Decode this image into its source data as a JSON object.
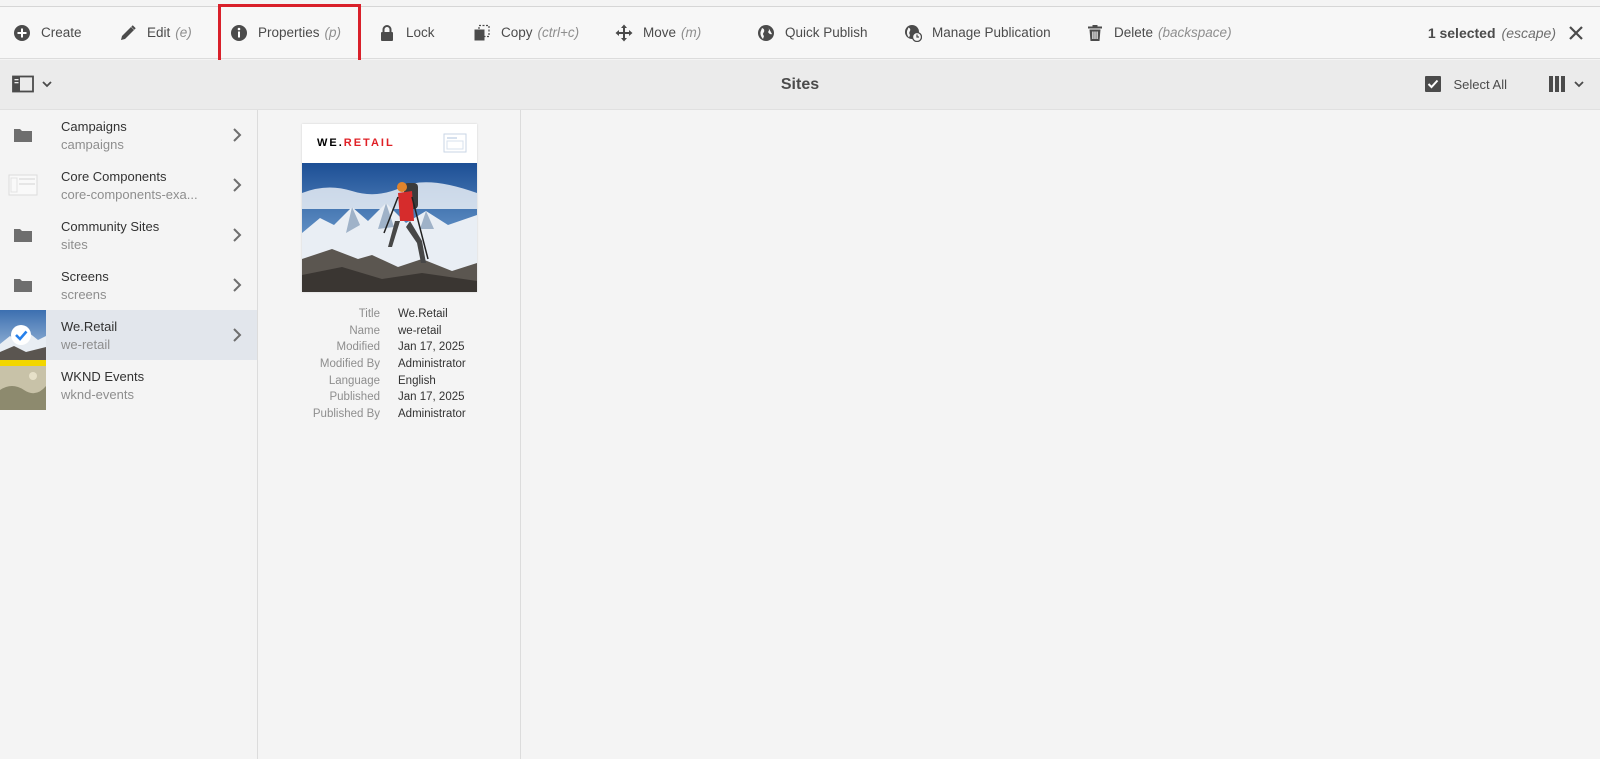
{
  "actionbar": {
    "actions": [
      {
        "label": "Create",
        "hint": "",
        "icon": "plus-circle-icon"
      },
      {
        "label": "Edit",
        "hint": "(e)",
        "icon": "pencil-icon"
      },
      {
        "label": "Properties",
        "hint": "(p)",
        "icon": "info-icon"
      },
      {
        "label": "Lock",
        "hint": "",
        "icon": "lock-icon"
      },
      {
        "label": "Copy",
        "hint": "(ctrl+c)",
        "icon": "copy-icon"
      },
      {
        "label": "Move",
        "hint": "(m)",
        "icon": "move-icon"
      },
      {
        "label": "Quick Publish",
        "hint": "",
        "icon": "globe-icon"
      },
      {
        "label": "Manage Publication",
        "hint": "",
        "icon": "globe-clock-icon"
      },
      {
        "label": "Delete",
        "hint": "(backspace)",
        "icon": "trash-icon"
      }
    ],
    "selected_text": "1 selected",
    "selected_hint": "(escape)"
  },
  "header": {
    "title": "Sites",
    "select_all": "Select All"
  },
  "column": {
    "items": [
      {
        "title": "Campaigns",
        "name": "campaigns",
        "icon": "folder-icon"
      },
      {
        "title": "Core Components",
        "name": "core-components-exa...",
        "icon": "site-thumbnail"
      },
      {
        "title": "Community Sites",
        "name": "sites",
        "icon": "folder-icon"
      },
      {
        "title": "Screens",
        "name": "screens",
        "icon": "folder-icon"
      },
      {
        "title": "We.Retail",
        "name": "we-retail",
        "icon": "check-circle-icon",
        "selected": true
      },
      {
        "title": "WKND Events",
        "name": "wknd-events",
        "icon": "site-thumbnail"
      }
    ]
  },
  "preview": {
    "logo_a": "WE.",
    "logo_b": "RETAIL",
    "meta": [
      {
        "key": "Title",
        "value": "We.Retail"
      },
      {
        "key": "Name",
        "value": "we-retail"
      },
      {
        "key": "Modified",
        "value": "Jan 17, 2025"
      },
      {
        "key": "Modified By",
        "value": "Administrator"
      },
      {
        "key": "Language",
        "value": "English"
      },
      {
        "key": "Published",
        "value": "Jan 17, 2025"
      },
      {
        "key": "Published By",
        "value": "Administrator"
      }
    ]
  },
  "colors": {
    "highlight": "#d9202a",
    "brand_red": "#e02026",
    "selected_row": "#e2e6ec"
  }
}
